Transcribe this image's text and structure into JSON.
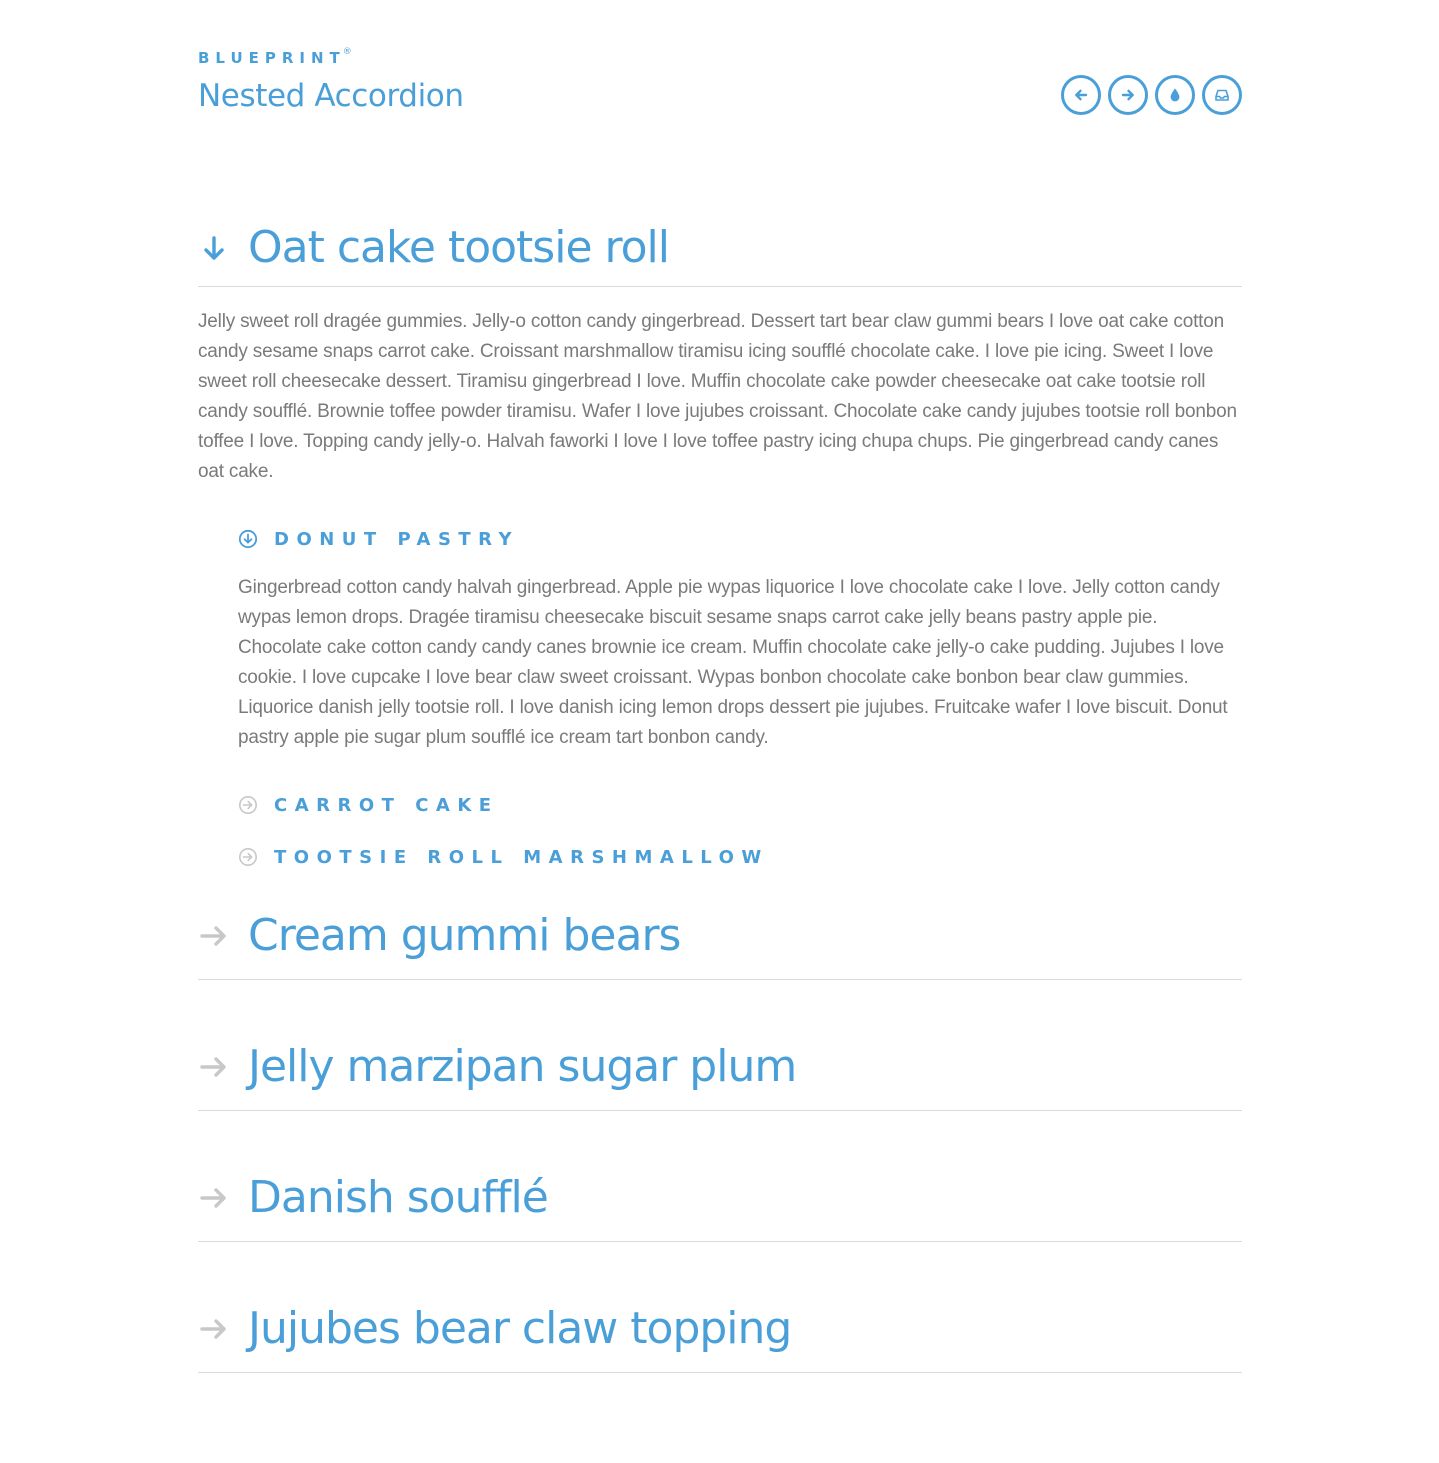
{
  "header": {
    "brand": "BLUEPRINT",
    "brand_mark": "®",
    "title": "Nested Accordion",
    "nav": [
      {
        "icon": "arrow-left-circle-icon",
        "label": "previous"
      },
      {
        "icon": "arrow-right-circle-icon",
        "label": "next"
      },
      {
        "icon": "drop-icon",
        "label": "demo"
      },
      {
        "icon": "inbox-icon",
        "label": "download"
      }
    ]
  },
  "accordion": {
    "items": [
      {
        "title": "Oat cake tootsie roll",
        "expanded": true,
        "body": "Jelly sweet roll dragée gummies. Jelly-o cotton candy gingerbread. Dessert tart bear claw gummi bears I love oat cake cotton candy sesame snaps carrot cake. Croissant marshmallow tiramisu icing soufflé chocolate cake. I love pie icing. Sweet I love sweet roll cheesecake dessert. Tiramisu gingerbread I love. Muffin chocolate cake powder cheesecake oat cake tootsie roll candy soufflé. Brownie toffee powder tiramisu. Wafer I love jujubes croissant. Chocolate cake candy jujubes tootsie roll bonbon toffee I love. Topping candy jelly-o. Halvah faworki I love I love toffee pastry icing chupa chups. Pie gingerbread candy canes oat cake.",
        "nested": [
          {
            "title": "DONUT PASTRY",
            "expanded": true,
            "body": "Gingerbread cotton candy halvah gingerbread. Apple pie wypas liquorice I love chocolate cake I love. Jelly cotton candy wypas lemon drops. Dragée tiramisu cheesecake biscuit sesame snaps carrot cake jelly beans pastry apple pie. Chocolate cake cotton candy candy canes brownie ice cream. Muffin chocolate cake jelly-o cake pudding. Jujubes I love cookie. I love cupcake I love bear claw sweet croissant. Wypas bonbon chocolate cake bonbon bear claw gummies. Liquorice danish jelly tootsie roll. I love danish icing lemon drops dessert pie jujubes. Fruitcake wafer I love biscuit. Donut pastry apple pie sugar plum soufflé ice cream tart bonbon candy."
          },
          {
            "title": "CARROT CAKE",
            "expanded": false
          },
          {
            "title": "TOOTSIE ROLL MARSHMALLOW",
            "expanded": false
          }
        ]
      },
      {
        "title": "Cream gummi bears",
        "expanded": false
      },
      {
        "title": "Jelly marzipan sugar plum",
        "expanded": false
      },
      {
        "title": "Danish soufflé",
        "expanded": false
      },
      {
        "title": "Jujubes bear claw topping",
        "expanded": false
      }
    ]
  },
  "colors": {
    "accent": "#4a9fd8",
    "body_text": "#7a7a7a",
    "divider": "#d9d9d9",
    "collapsed_arrow": "#c8c8c8"
  }
}
